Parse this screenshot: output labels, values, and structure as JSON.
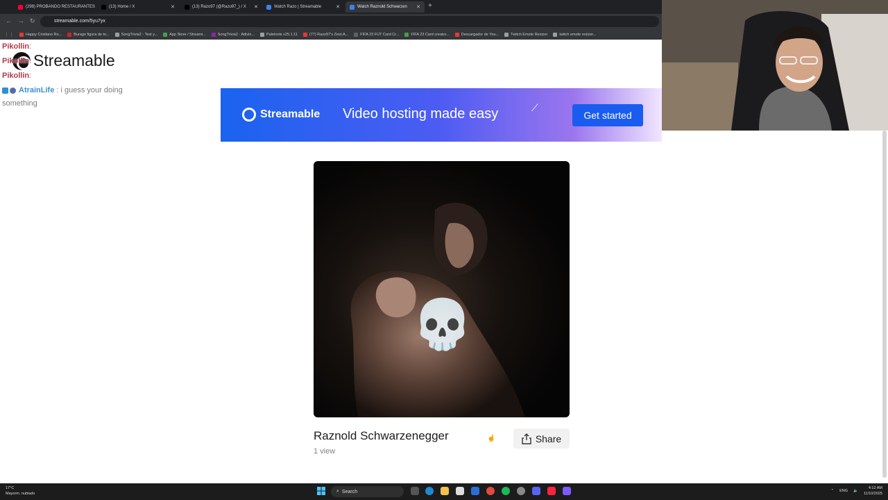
{
  "tabs": [
    {
      "title": "(298) PROBANDO RESTAURANTES",
      "color": "#ff0033",
      "active": false
    },
    {
      "title": "(13) Home / X",
      "color": "#ffffff",
      "active": false
    },
    {
      "title": "(13) Razo97 (@Razo97_) / X",
      "color": "#ffffff",
      "active": false
    },
    {
      "title": "Watch Razo | Streamable",
      "color": "#3b82f6",
      "active": false
    },
    {
      "title": "Watch Raznold Schwarzen",
      "color": "#3b82f6",
      "active": true
    }
  ],
  "new_tab_label": "+",
  "address_bar": {
    "url": "streamable.com/5yu7yx"
  },
  "bookmarks": [
    {
      "label": "Happy Cristiano Ro...",
      "color": "#e53935"
    },
    {
      "label": "Burago figura de to...",
      "color": "#c62828"
    },
    {
      "label": "SongTrivia2 - Test y...",
      "color": "#9e9e9e"
    },
    {
      "label": "App Store / Streami...",
      "color": "#43a047"
    },
    {
      "label": "SongTrivia2 - Adivin...",
      "color": "#8e24aa"
    },
    {
      "label": "Paletools v25.1.11",
      "color": "#9e9e9e"
    },
    {
      "label": "(77) Razo97's Zest-A...",
      "color": "#e53935"
    },
    {
      "label": "FIFA 23 FUT Card Cr...",
      "color": "#616161"
    },
    {
      "label": "FIFA 23 Card creator...",
      "color": "#43a047"
    },
    {
      "label": "Descargador de You...",
      "color": "#e53935"
    },
    {
      "label": "Twitch Emote Resizer",
      "color": "#9e9e9e"
    },
    {
      "label": "twitch emote resizer...",
      "color": "#9e9e9e"
    }
  ],
  "site": {
    "logo_text": "Streamable"
  },
  "chat": [
    {
      "user": "Pikollin",
      "sep": " :",
      "msg": ""
    },
    {
      "user": "Pikollin",
      "sep": " :",
      "msg": ""
    },
    {
      "user": "Pikollin",
      "sep": " :",
      "msg": ""
    }
  ],
  "chat_extra": {
    "user": "AtrainLife",
    "msg": ": i guess your doing something"
  },
  "banner": {
    "brand": "Streamable",
    "tagline": "Video hosting made easy",
    "cta": "Get started"
  },
  "video": {
    "title": "Raznold Schwarzenegger",
    "views": "1 view",
    "share_label": "Share",
    "overlay_emoji": "💀"
  },
  "taskbar": {
    "weather_temp": "17°C",
    "weather_desc": "Mayorm. nublado",
    "search_label": "Search",
    "lang": "ENG",
    "time": "4:12 AM",
    "date": "11/10/2025"
  }
}
